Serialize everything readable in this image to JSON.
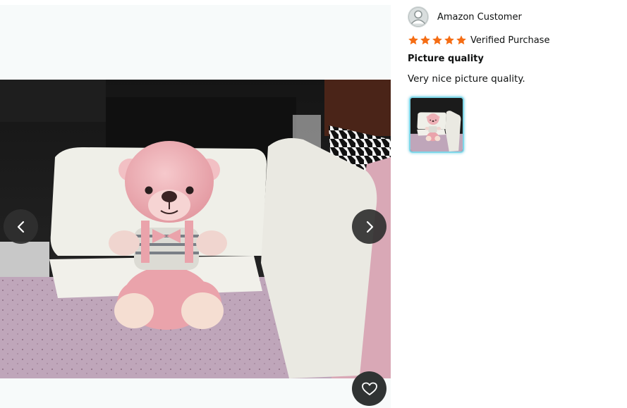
{
  "viewer": {
    "photo_alt": "Customer photo",
    "prev_icon": "chevron-left-icon",
    "next_icon": "chevron-right-icon",
    "favorite_icon": "heart-icon"
  },
  "review": {
    "author": "Amazon Customer",
    "rating": 5,
    "rating_max": 5,
    "verified": "Verified Purchase",
    "title": "Picture quality",
    "body": "Very nice picture quality."
  },
  "colors": {
    "star": "#ff9900",
    "thumb_border": "#7fd7e8",
    "viewer_bg": "#f7fafa",
    "button_bg": "#303333"
  }
}
